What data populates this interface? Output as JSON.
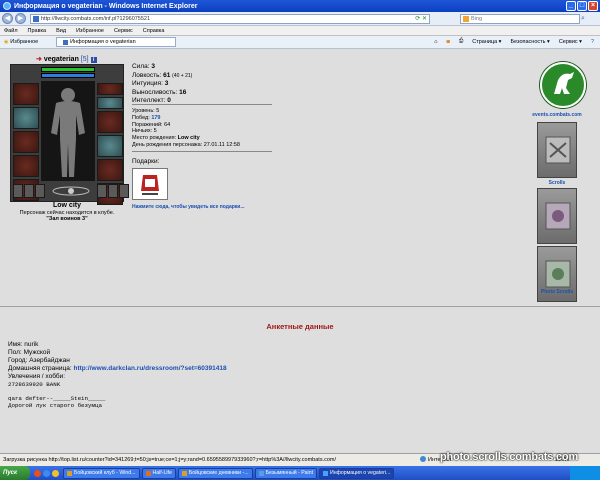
{
  "window": {
    "title": "Информация о vegaterian - Windows Internet Explorer"
  },
  "browser": {
    "back_icon": "back-arrow-icon",
    "forward_icon": "forward-arrow-icon",
    "url": "http://llwcity.combats.com/inf.pl?1296075521",
    "search_placeholder": "Bing",
    "menu": [
      "Файл",
      "Правка",
      "Вид",
      "Избранное",
      "Сервис",
      "Справка"
    ],
    "favorites_label": "Избранное",
    "tab_title": "Информация о vegaterian",
    "toolbar_right": [
      "Страница ▾",
      "Безопасность ▾",
      "Сервис ▾"
    ]
  },
  "character": {
    "name": "vegaterian",
    "level": "[5]",
    "info_badge": "i",
    "hp_fraction": 1.0,
    "mp_fraction": 1.0,
    "city": "Low city",
    "location_text": "Персонаж сейчас находится в клубе.",
    "room": "\"Зал воинов 3\""
  },
  "stats": {
    "strength_label": "Сила:",
    "strength": "3",
    "agility_label": "Ловкость:",
    "agility": "61",
    "agility_extra": "(40 + 21)",
    "intuition_label": "Интуиция:",
    "intuition": "3",
    "endurance_label": "Выносливость:",
    "endurance": "16",
    "intellect_label": "Интеллект:",
    "intellect": "0"
  },
  "details": {
    "level_label": "Уровень:",
    "level": "5",
    "wins_label": "Побед:",
    "wins": "179",
    "losses_label": "Поражений:",
    "losses": "64",
    "draws_label": "Ничьих:",
    "draws": "5",
    "birthplace_label": "Место рождения:",
    "birthplace": "Low city",
    "birthday_label": "День рождения персонажа:",
    "birthday": "27.01.11 12:58"
  },
  "gifts": {
    "title": "Подарки:",
    "link_text": "Нажмите сюда, чтобы увидеть все подарки..."
  },
  "banners": [
    {
      "icon": "goat-logo-icon",
      "caption": "events.combats.com"
    },
    {
      "icon": "scroll-banner-icon",
      "caption": "Scrolls"
    },
    {
      "icon": "photo-banner-icon",
      "caption": "Photo Scrolls"
    }
  ],
  "profile": {
    "title": "Анкетные данные",
    "name_label": "Имя:",
    "name": "nurik",
    "gender_label": "Пол:",
    "gender": "Мужской",
    "city_label": "Город:",
    "city": "Азербайджан",
    "homepage_label": "Домашняя страница:",
    "homepage": "http://www.darkclan.ru/dressroom/?set=60391418",
    "hobbies_label": "Увлечения / хобби:",
    "hobby_line1": "2728639920 BANK",
    "motto_line1": "qara  defter--_____Stein_____",
    "motto_line2": "Дорогой лук старого безумца"
  },
  "status": {
    "message": "Загрузка рисунка http://top.list.ru/counter?id=341269;t=50;js=true;ce=1;j=y;rand=0.659558997933960?;r=http%3A//llwcity.combats.com/",
    "zone": "Интернет",
    "zoom": "100%"
  },
  "watermark": "photo.scrolls.combats.com",
  "taskbar": {
    "start": "Пуск",
    "tasks": [
      "Бойцовский клуб - Wind...",
      "Half-Life",
      "Бойцовские дневники -...",
      "Безымянный - Paint",
      "Информация о vegateri..."
    ],
    "tray": ""
  }
}
